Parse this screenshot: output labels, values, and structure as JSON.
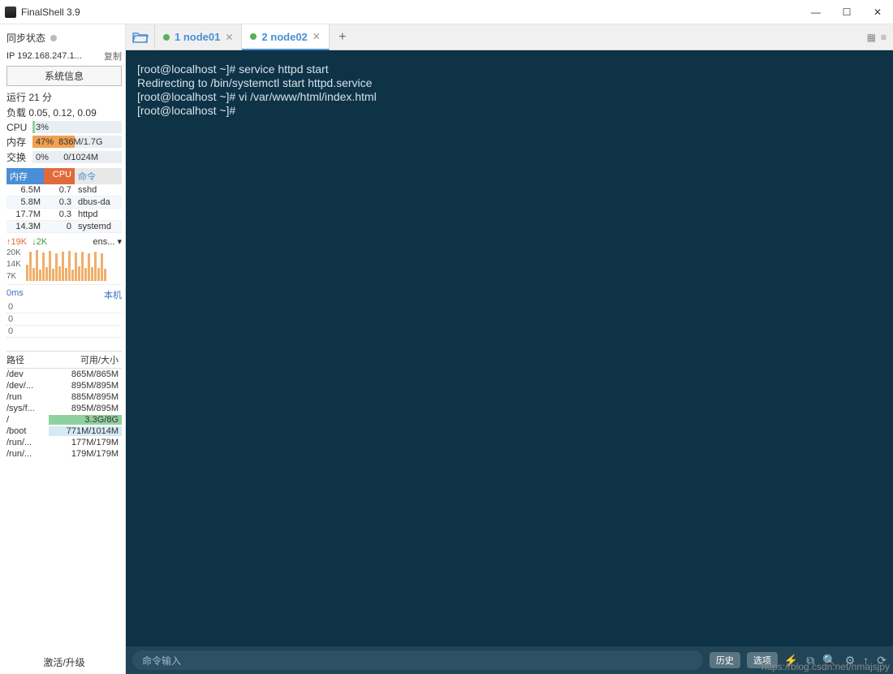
{
  "window": {
    "title": "FinalShell 3.9"
  },
  "sidebar": {
    "sync_label": "同步状态",
    "ip": "IP 192.168.247.1...",
    "copy": "复制",
    "sysinfo_btn": "系统信息",
    "uptime": "运行 21 分",
    "load": "负载 0.05, 0.12, 0.09",
    "cpu_label": "CPU",
    "cpu_pct": "3%",
    "mem_label": "内存",
    "mem_pct": "47%",
    "mem_txt": "836M/1.7G",
    "swap_label": "交换",
    "swap_pct": "0%",
    "swap_txt": "0/1024M",
    "proc_head": {
      "mem": "内存",
      "cpu": "CPU",
      "cmd": "命令"
    },
    "procs": [
      {
        "mem": "6.5M",
        "cpu": "0.7",
        "cmd": "sshd"
      },
      {
        "mem": "5.8M",
        "cpu": "0.3",
        "cmd": "dbus-da"
      },
      {
        "mem": "17.7M",
        "cpu": "0.3",
        "cmd": "httpd"
      },
      {
        "mem": "14.3M",
        "cpu": "0",
        "cmd": "systemd"
      }
    ],
    "net": {
      "up": "↑19K",
      "down": "↓2K",
      "iface": "ens... ▾"
    },
    "spark_y": [
      "20K",
      "14K",
      "7K"
    ],
    "ping": {
      "left": "0ms",
      "right": "本机"
    },
    "ping_vals": [
      "0",
      "0",
      "0"
    ],
    "disk_head": {
      "path": "路径",
      "size": "可用/大小"
    },
    "disks": [
      {
        "p": "/dev",
        "s": "865M/865M"
      },
      {
        "p": "/dev/...",
        "s": "895M/895M"
      },
      {
        "p": "/run",
        "s": "885M/895M"
      },
      {
        "p": "/sys/f...",
        "s": "895M/895M"
      },
      {
        "p": "/",
        "s": "3.3G/8G"
      },
      {
        "p": "/boot",
        "s": "771M/1014M"
      },
      {
        "p": "/run/...",
        "s": "177M/179M"
      },
      {
        "p": "/run/...",
        "s": "179M/179M"
      }
    ],
    "activate": "激活/升级"
  },
  "tabs": [
    {
      "label": "1 node01"
    },
    {
      "label": "2 node02"
    }
  ],
  "terminal": {
    "lines": "[root@localhost ~]# service httpd start\nRedirecting to /bin/systemctl start httpd.service\n[root@localhost ~]# vi /var/www/html/index.html\n[root@localhost ~]# "
  },
  "bottombar": {
    "placeholder": "命令输入",
    "history": "历史",
    "options": "选项"
  },
  "watermark": "https://blog.csdn.net/nmajsjpy"
}
